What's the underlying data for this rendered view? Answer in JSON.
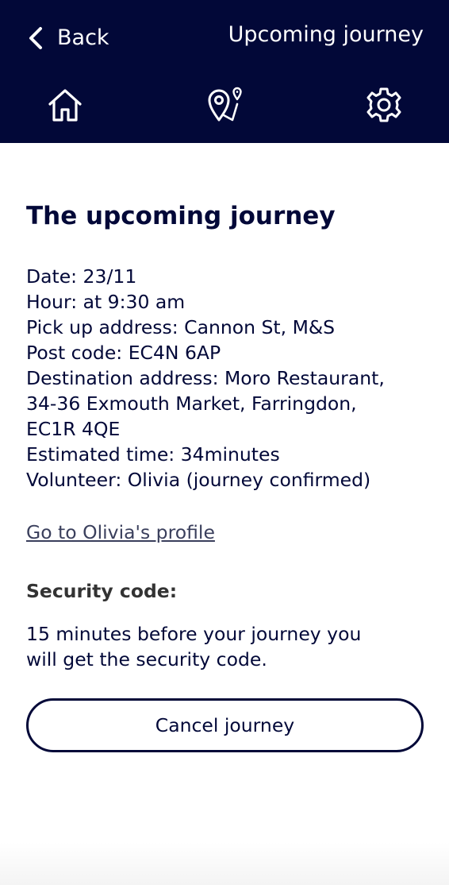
{
  "header": {
    "back_label": "Back",
    "title": "Upcoming journey",
    "background": "#020838",
    "nav": [
      {
        "icon": "home-icon"
      },
      {
        "icon": "map-pin-icon"
      },
      {
        "icon": "gear-icon"
      }
    ]
  },
  "main": {
    "title": "The upcoming journey",
    "details": [
      "Date: 23/11",
      "Hour: at 9:30 am",
      "Pick up address: Cannon St, M&S",
      "Post code: EC4N 6AP",
      "Destination address: Moro Restaurant,",
      "34-36 Exmouth Market, Farringdon,",
      "EC1R 4QE",
      "Estimated time: 34minutes",
      "Volunteer: Olivia (journey confirmed)"
    ],
    "profile_link": "Go to Olivia's profile",
    "security_heading": "Security code:",
    "security_text_lines": [
      "15 minutes before your journey you",
      "will get the security code."
    ],
    "cancel_label": "Cancel journey"
  },
  "colors": {
    "primary": "#020838",
    "link": "#3a3f5c",
    "heading_grey": "#333333"
  }
}
